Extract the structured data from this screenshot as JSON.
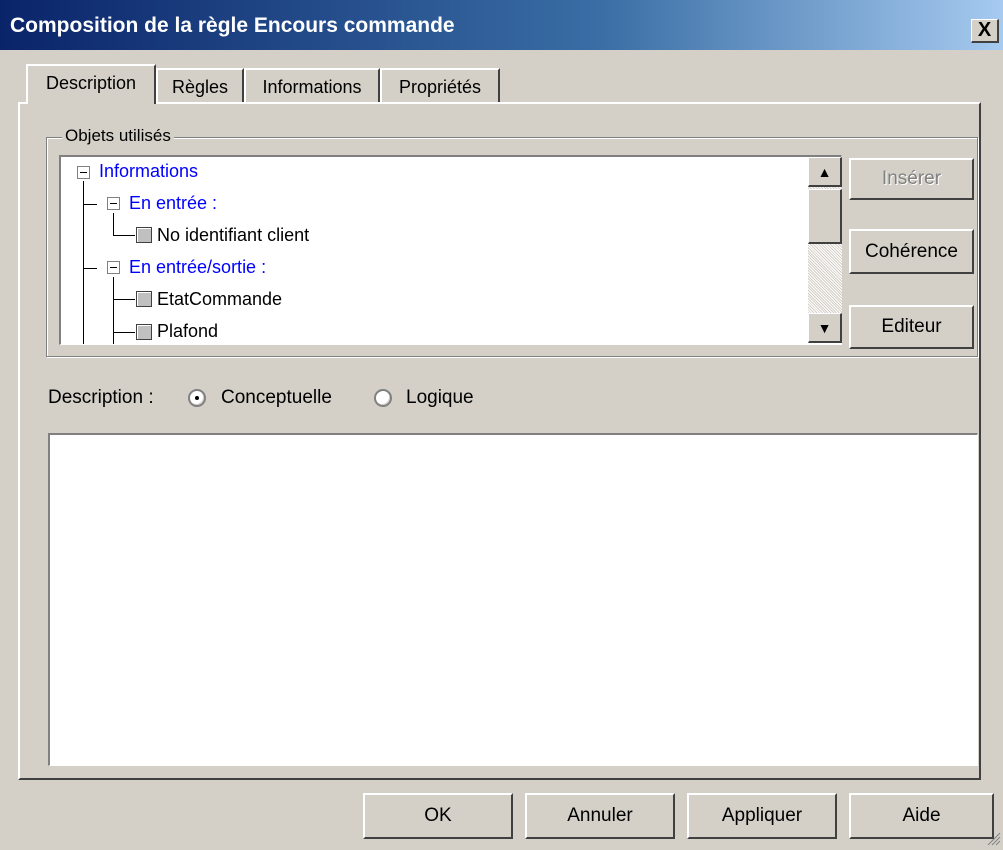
{
  "window": {
    "title": "Composition de la règle Encours commande",
    "close_label": "X"
  },
  "tabs": [
    {
      "label": "Description",
      "active": true
    },
    {
      "label": "Règles",
      "active": false
    },
    {
      "label": "Informations",
      "active": false
    },
    {
      "label": "Propriétés",
      "active": false
    }
  ],
  "objects_group": {
    "label": "Objets utilisés",
    "tree": [
      {
        "label": "Informations",
        "level": 0,
        "expanded": true,
        "color": "#0000ff"
      },
      {
        "label": "En entrée :",
        "level": 1,
        "expanded": true,
        "color": "#0000ff"
      },
      {
        "label": "No identifiant client",
        "level": 2,
        "leaf": true
      },
      {
        "label": "En entrée/sortie :",
        "level": 1,
        "expanded": true,
        "color": "#0000ff"
      },
      {
        "label": "EtatCommande",
        "level": 2,
        "leaf": true
      },
      {
        "label": "Plafond",
        "level": 2,
        "leaf": true
      }
    ],
    "buttons": {
      "inserer": "Insérer",
      "coherence": "Cohérence",
      "editeur": "Editeur"
    }
  },
  "description": {
    "label": "Description :",
    "options": [
      {
        "label": "Conceptuelle",
        "checked": true
      },
      {
        "label": "Logique",
        "checked": false
      }
    ],
    "text": ""
  },
  "footer": {
    "ok": "OK",
    "annuler": "Annuler",
    "appliquer": "Appliquer",
    "aide": "Aide"
  }
}
